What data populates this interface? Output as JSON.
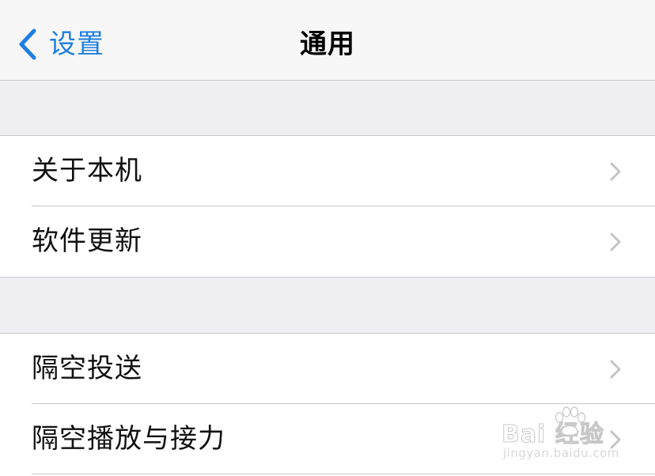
{
  "nav": {
    "back_label": "设置",
    "title": "通用"
  },
  "groups": [
    {
      "items": [
        {
          "label": "关于本机"
        },
        {
          "label": "软件更新"
        }
      ]
    },
    {
      "items": [
        {
          "label": "隔空投送"
        },
        {
          "label": "隔空播放与接力"
        }
      ]
    }
  ],
  "watermark": {
    "logo_text": "Bai  经验",
    "url": "jingyan.baidu.com"
  },
  "colors": {
    "accent": "#1f7fe0",
    "background": "#efeff4",
    "separator": "#c8c7cc",
    "chevron": "#c4c4c7"
  }
}
